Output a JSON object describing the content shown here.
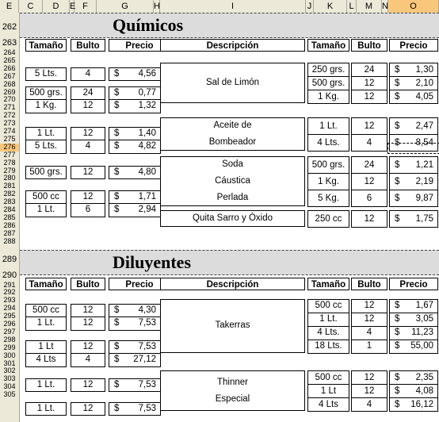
{
  "columns": [
    "E",
    "C",
    "D",
    "E",
    "F",
    "G",
    "H",
    "I",
    "J",
    "K",
    "L",
    "M",
    "N",
    "O"
  ],
  "selected_column": "O",
  "selected_row": "276",
  "rows": [
    "262",
    "263",
    "264",
    "265",
    "266",
    "267",
    "268",
    "269",
    "270",
    "271",
    "272",
    "273",
    "274",
    "275",
    "276",
    "277",
    "278",
    "279",
    "280",
    "281",
    "282",
    "283",
    "284",
    "285",
    "286",
    "287",
    "288",
    "289",
    "290",
    "291",
    "292",
    "293",
    "294",
    "295",
    "296",
    "297",
    "298",
    "299",
    "300",
    "301",
    "302",
    "303",
    "304",
    "305"
  ],
  "headers": {
    "size": "Tamaño",
    "pack": "Bulto",
    "price": "Precio",
    "desc": "Descripción"
  },
  "currency": "$",
  "sections": [
    {
      "title": "Químicos",
      "left": [
        {
          "size": "5 Lts.",
          "pack": "4",
          "price": "4,56"
        },
        {
          "size": "500 grs.",
          "pack": "24",
          "price": "0,77"
        },
        {
          "size": "1 Kg.",
          "pack": "12",
          "price": "1,32"
        },
        {
          "size": "1 Lt.",
          "pack": "12",
          "price": "1,40"
        },
        {
          "size": "5 Lts.",
          "pack": "4",
          "price": "4,82"
        },
        {
          "size": "500 grs.",
          "pack": "12",
          "price": "4,80"
        },
        {
          "size": "500 cc",
          "pack": "12",
          "price": "1,71"
        },
        {
          "size": "1 Lt.",
          "pack": "6",
          "price": "2,94"
        }
      ],
      "products": [
        {
          "desc": [
            "Sal de Limón"
          ],
          "items": [
            {
              "size": "250 grs.",
              "pack": "24",
              "price": "1,30"
            },
            {
              "size": "500 grs.",
              "pack": "12",
              "price": "2,10"
            },
            {
              "size": "1 Kg.",
              "pack": "12",
              "price": "4,05"
            }
          ]
        },
        {
          "desc": [
            "Aceite de",
            "Bombeador"
          ],
          "items": [
            {
              "size": "1 Lt.",
              "pack": "12",
              "price": "2,47"
            },
            {
              "size": "4 Lts.",
              "pack": "4",
              "price": "8,54"
            }
          ]
        },
        {
          "desc": [
            "Soda",
            "Cáustica",
            "Perlada"
          ],
          "items": [
            {
              "size": "500 grs.",
              "pack": "24",
              "price": "1,21"
            },
            {
              "size": "1 Kg.",
              "pack": "12",
              "price": "2,19"
            },
            {
              "size": "5 Kg.",
              "pack": "6",
              "price": "9,87"
            }
          ]
        },
        {
          "desc": [
            "Quita Sarro y Óxido"
          ],
          "items": [
            {
              "size": "250 cc",
              "pack": "12",
              "price": "1,75"
            }
          ]
        }
      ]
    },
    {
      "title": "Diluyentes",
      "left": [
        {
          "size": "500 cc",
          "pack": "12",
          "price": "4,30"
        },
        {
          "size": "1 Lt.",
          "pack": "12",
          "price": "7,53"
        },
        {
          "size": "1 Lt",
          "pack": "12",
          "price": "7,53"
        },
        {
          "size": "4 Lts",
          "pack": "4",
          "price": "27,12"
        },
        {
          "size": "1 Lt.",
          "pack": "12",
          "price": "7,53"
        },
        {
          "size": "1 Lt.",
          "pack": "12",
          "price": "7,53"
        }
      ],
      "products": [
        {
          "desc": [
            "Takerras"
          ],
          "items": [
            {
              "size": "500 cc",
              "pack": "12",
              "price": "1,67"
            },
            {
              "size": "1 Lt.",
              "pack": "12",
              "price": "3,05"
            },
            {
              "size": "4 Lts.",
              "pack": "4",
              "price": "11,23"
            },
            {
              "size": "18 Lts.",
              "pack": "1",
              "price": "55,00"
            }
          ]
        },
        {
          "desc": [
            "Thinner",
            "Especial"
          ],
          "items": [
            {
              "size": "500 cc",
              "pack": "12",
              "price": "2,35"
            },
            {
              "size": "1 Lt",
              "pack": "12",
              "price": "4,08"
            },
            {
              "size": "4 Lts",
              "pack": "4",
              "price": "16,12"
            }
          ]
        }
      ]
    }
  ]
}
